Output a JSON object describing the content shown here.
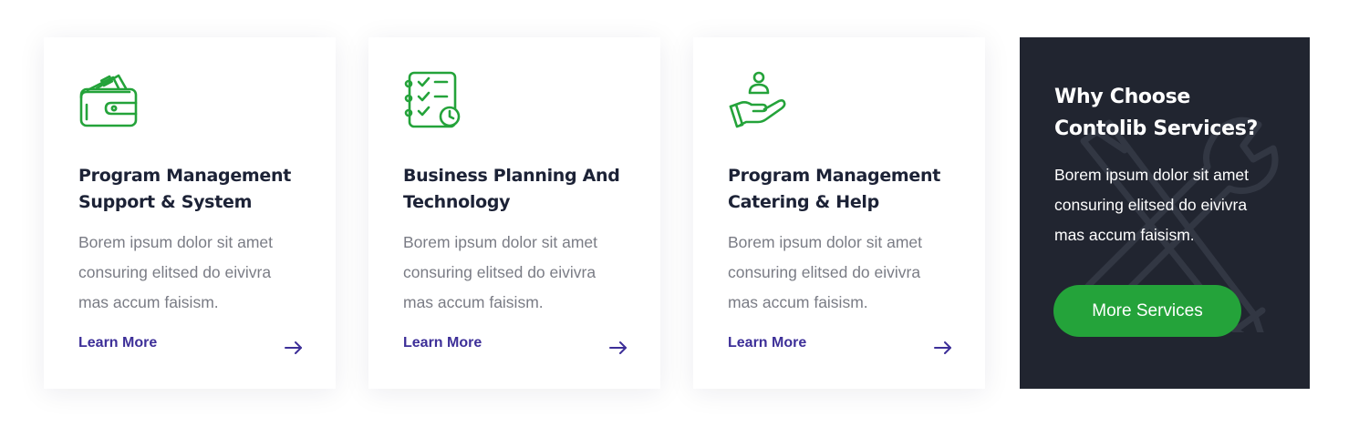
{
  "colors": {
    "accent_green": "#24a33a",
    "link_purple": "#3d2f98",
    "heading_dark": "#1c2236",
    "body_gray": "#7a7c85",
    "dark_panel": "#212530"
  },
  "cards": [
    {
      "icon": "wallet-icon",
      "title_line1": "Program Management",
      "title_line2": "Support & System",
      "desc_line1": "Borem ipsum dolor sit amet",
      "desc_line2": "consuring elitsed do eivivra",
      "desc_line3": "mas accum faisism.",
      "link_label": "Learn More",
      "link_icon": "arrow-right-icon"
    },
    {
      "icon": "checklist-icon",
      "title_line1": "Business Planning And",
      "title_line2": "Technology",
      "desc_line1": "Borem ipsum dolor sit amet",
      "desc_line2": "consuring elitsed do eivivra",
      "desc_line3": "mas accum faisism.",
      "link_label": "Learn More",
      "link_icon": "arrow-right-icon"
    },
    {
      "icon": "hand-person-icon",
      "title_line1": "Program Management",
      "title_line2": "Catering & Help",
      "desc_line1": "Borem ipsum dolor sit amet",
      "desc_line2": "consuring elitsed do eivivra",
      "desc_line3": "mas accum faisism.",
      "link_label": "Learn More",
      "link_icon": "arrow-right-icon"
    }
  ],
  "why": {
    "title_line1": "Why Choose",
    "title_line2": "Contolib Services?",
    "desc_line1": "Borem ipsum dolor sit amet",
    "desc_line2": "consuring elitsed do eivivra",
    "desc_line3": "mas accum faisism.",
    "button_label": "More Services",
    "background_icon": "wrench-pencil-icon"
  }
}
